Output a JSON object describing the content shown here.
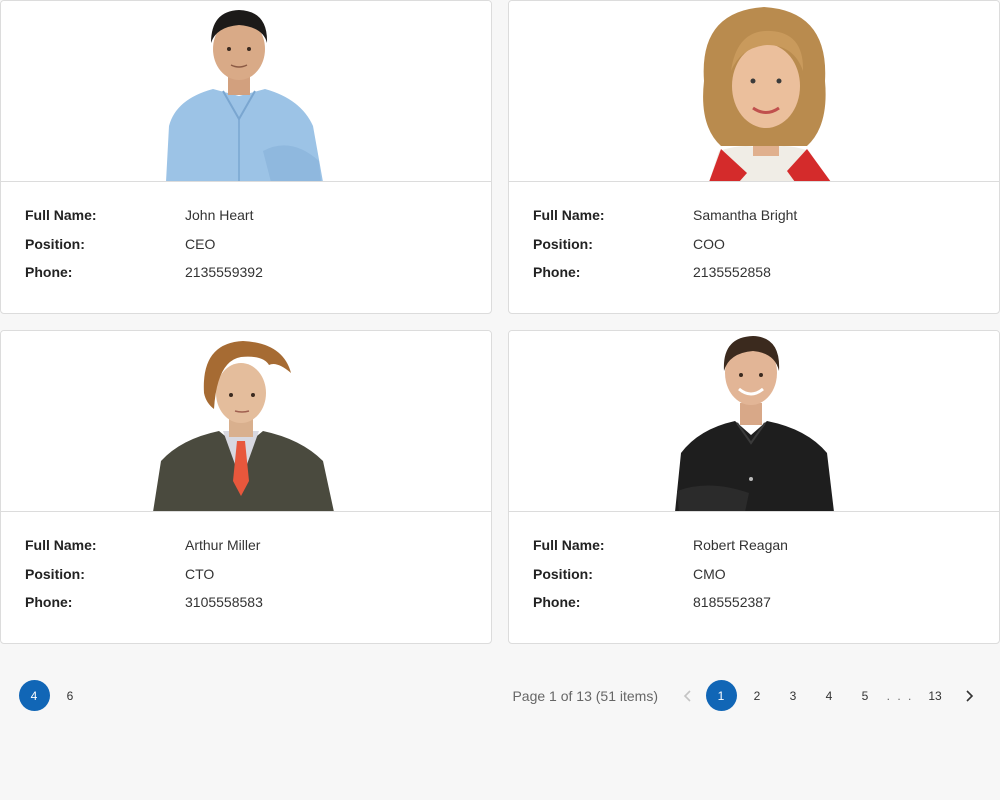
{
  "labels": {
    "full_name": "Full Name:",
    "position": "Position:",
    "phone": "Phone:"
  },
  "employees": [
    {
      "full_name": "John Heart",
      "position": "CEO",
      "phone": "2135559392"
    },
    {
      "full_name": "Samantha Bright",
      "position": "COO",
      "phone": "2135552858"
    },
    {
      "full_name": "Arthur Miller",
      "position": "CTO",
      "phone": "3105558583"
    },
    {
      "full_name": "Robert Reagan",
      "position": "CMO",
      "phone": "8185552387"
    }
  ],
  "page_size_selector": {
    "options": [
      "4",
      "6"
    ],
    "selected": "4"
  },
  "pager": {
    "info": "Page 1 of 13 (51 items)",
    "pages": [
      "1",
      "2",
      "3",
      "4",
      "5"
    ],
    "ellipsis": ". . .",
    "last_page": "13",
    "current": "1",
    "prev_icon": "chevron-left-icon",
    "next_icon": "chevron-right-icon"
  },
  "colors": {
    "accent": "#1166b6",
    "card_border": "#dcdcdc",
    "background": "#f7f7f7"
  }
}
